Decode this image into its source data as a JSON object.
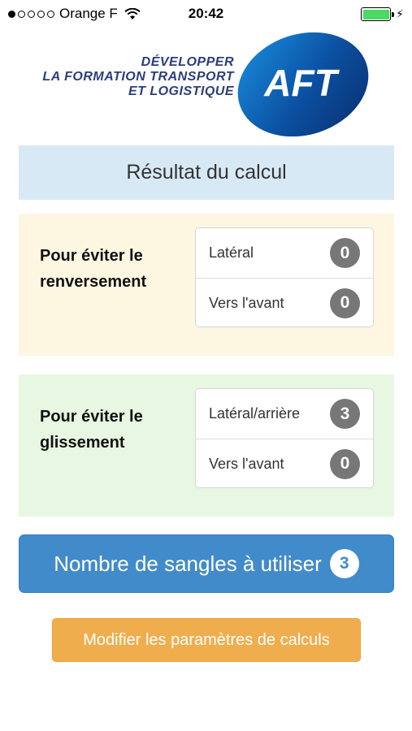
{
  "status_bar": {
    "carrier": "Orange F",
    "time": "20:42",
    "signal_bars_filled": 1,
    "signal_bars_total": 5,
    "battery_level": 1.0,
    "battery_color": "#4cd964"
  },
  "logo": {
    "line1": "DÉVELOPPER",
    "line2": "LA FORMATION TRANSPORT",
    "line3": "ET LOGISTIQUE",
    "mark": "AFT"
  },
  "header": {
    "title": "Résultat du calcul"
  },
  "overturn": {
    "title": "Pour éviter le renversement",
    "items": [
      {
        "label": "Latéral",
        "value": "0"
      },
      {
        "label": "Vers l'avant",
        "value": "0"
      }
    ]
  },
  "slide": {
    "title": "Pour éviter le glissement",
    "items": [
      {
        "label": "Latéral/arrière",
        "value": "3"
      },
      {
        "label": "Vers l'avant",
        "value": "0"
      }
    ]
  },
  "total": {
    "label": "Nombre de sangles à utiliser",
    "value": "3"
  },
  "modify_button": {
    "label": "Modifier les paramètres de calculs"
  },
  "colors": {
    "primary": "#428bca",
    "warning": "#f0ad4e",
    "info_bg": "#d8e9f6",
    "warning_bg": "#fdf6e1",
    "success_bg": "#e7f7e1"
  }
}
